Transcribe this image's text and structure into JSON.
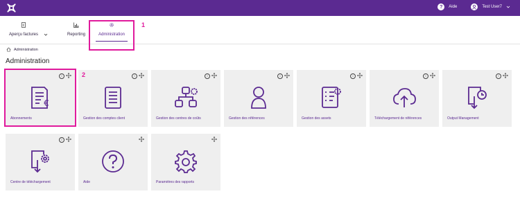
{
  "header": {
    "help_label": "Aide",
    "user_label": "Test User7",
    "help_symbol": "?"
  },
  "tabs": [
    {
      "label": "Aperçu factures"
    },
    {
      "label": "Reporting"
    },
    {
      "label": "Administration"
    }
  ],
  "annotations": {
    "first": "1",
    "second": "2"
  },
  "breadcrumb": {
    "label": "Administration"
  },
  "page_title": "Administration",
  "card_controls": {
    "info": "i"
  },
  "cards": [
    {
      "label": "Abonnements"
    },
    {
      "label": "Gestion des comptes client"
    },
    {
      "label": "Gestion des centres de coûts"
    },
    {
      "label": "Gestion des références"
    },
    {
      "label": "Gestion des assets"
    },
    {
      "label": "Téléchargement de références"
    },
    {
      "label": "Output Management"
    },
    {
      "label": "Centre de téléchargement"
    },
    {
      "label": "Aide"
    },
    {
      "label": "Paramètres des rapports"
    }
  ],
  "colors": {
    "brand": "#5b2a91",
    "highlight": "#e0199c",
    "card_bg": "#efefef"
  }
}
